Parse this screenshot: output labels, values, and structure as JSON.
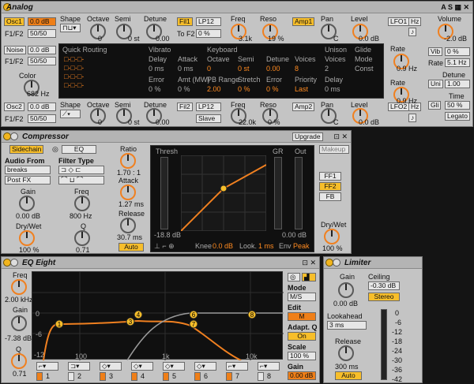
{
  "analog": {
    "title": "Analog",
    "osc1": "Osc1",
    "osc1_db": "0.0 dB",
    "f1f2": "F1/F2",
    "f1f2_val": "50/50",
    "shape": "Shape",
    "octave": "Octave",
    "octave_v": "0",
    "semi": "Semi",
    "semi_v": "0 st",
    "detune": "Detune",
    "detune_v": "0.00",
    "fil1": "Fil1",
    "fil1_type": "LP12",
    "freq": "Freq",
    "freq_v": "3.1k",
    "reso": "Reso",
    "reso_v": "19 %",
    "tof2": "To F2",
    "tof2_v": "0 %",
    "amp1": "Amp1",
    "pan": "Pan",
    "pan_v": "C",
    "level": "Level",
    "level_v": "0.0 dB",
    "lfo1": "LFO1",
    "hz": "Hz",
    "volume": "Volume",
    "volume_v": "-2.0 dB",
    "noise": "Noise",
    "noise_db": "0.0 dB",
    "noise_f": "F1/F2",
    "noise_f_v": "50/50",
    "color": "Color",
    "color_v": "682 Hz",
    "qr": "Quick Routing",
    "vibrato": "Vibrato",
    "v_delay": "Delay",
    "v_delay_v": "0 ms",
    "v_error": "Error",
    "v_error_v": "0 %",
    "keyboard": "Keyboard",
    "k_attack": "Attack",
    "k_attack_v": "0 ms",
    "k_octave": "Octave",
    "k_octave_v": "0",
    "k_semi": "Semi",
    "k_semi_v": "0 st",
    "k_detune": "Detune",
    "k_detune_v": "0.00",
    "k_amt": "Amt (MW)",
    "k_amt_v": "0 %",
    "k_fb": "PB Range",
    "k_fb_v": "2.00",
    "k_stretch": "Stretch",
    "k_stretch_v": "0 %",
    "k_error": "Error",
    "k_error_v": "0 %",
    "unison": "Unison",
    "u_voices": "Voices",
    "u_voices_v": "8",
    "u_voices2": "Voices",
    "u_voices2_v": "2",
    "u_priority": "Priority",
    "u_priority_v": "Last",
    "u_delay": "Delay",
    "u_delay_v": "0 ms",
    "glide": "Glide",
    "g_mode": "Mode",
    "g_mode_v": "Const",
    "rate": "Rate",
    "rate_v": "0.9 Hz",
    "vib": "Vib",
    "vib_v": "0 %",
    "rate2": "Rate",
    "rate2_v": "5.1 Hz",
    "uni": "Uni",
    "uni_v": "1.00",
    "detune2": "Detune",
    "glide2": "Gli",
    "glide2_v": "50 %",
    "time": "Time",
    "legato": "Legato",
    "osc2": "Osc2",
    "osc2_db": "0.0 dB",
    "osc2_f": "F1/F2",
    "osc2_f_v": "50/50",
    "shape2": "Shape",
    "octave2": "Octave",
    "octave2_v": "0",
    "semi2": "Semi",
    "semi2_v": "0 st",
    "detune3": "Detune",
    "detune3_v": "0.00",
    "fil2": "Fil2",
    "fil2_type": "LP12",
    "freq2": "Freq",
    "freq2_v": "22.0k",
    "reso2": "Reso",
    "reso2_v": "0 %",
    "slave": "Slave",
    "amp2": "Amp2",
    "pan2": "Pan",
    "pan2_v": "C",
    "level2": "Level",
    "level2_v": "0.0 dB",
    "lfo2": "LFO2",
    "hz2": "Hz",
    "rate3": "Rate",
    "rate3_v": "0.9 Hz"
  },
  "comp": {
    "title": "Compressor",
    "upgrade": "Upgrade",
    "sidechain": "Sidechain",
    "eq": "EQ",
    "audio_from": "Audio From",
    "breaks": "breaks",
    "postfx": "Post FX",
    "filter_type": "Filter Type",
    "gain": "Gain",
    "gain_v": "0.00 dB",
    "freq": "Freq",
    "freq_v": "800 Hz",
    "drywet": "Dry/Wet",
    "drywet_v": "100 %",
    "q": "Q",
    "q_v": "0.71",
    "ratio": "Ratio",
    "ratio_v": "1.70 : 1",
    "attack": "Attack",
    "attack_v": "1.27 ms",
    "release": "Release",
    "release_v": "30.7 ms",
    "auto": "Auto",
    "thresh": "Thresh",
    "gr": "GR",
    "out": "Out",
    "thresh_v": "-18.8 dB",
    "out_v": "0.00 dB",
    "knee": "Knee",
    "knee_v": "0.0 dB",
    "look": "Look.",
    "look_v": "1 ms",
    "env": "Env",
    "env_v": "Peak",
    "makeup": "Makeup",
    "ff1": "FF1",
    "ff2": "FF2",
    "fb": "FB",
    "dw2": "Dry/Wet",
    "dw2_v": "100 %"
  },
  "eq": {
    "title": "EQ Eight",
    "freq": "Freq",
    "freq_v": "2.00 kHz",
    "gain": "Gain",
    "gain_v": "-7.38 dB",
    "q": "Q",
    "q_v": "0.71",
    "ticks": [
      "0",
      "-6",
      "-12"
    ],
    "xticks": [
      "100",
      "1k",
      "10k"
    ],
    "mode": "Mode",
    "mode_v": "M/S",
    "edit": "Edit",
    "edit_v": "M",
    "adapt": "Adapt. Q",
    "adapt_v": "On",
    "scale": "Scale",
    "scale_v": "100 %",
    "gain2": "Gain",
    "gain2_v": "0.00 dB",
    "bands": [
      "1",
      "2",
      "3",
      "4",
      "5",
      "6",
      "7",
      "8"
    ]
  },
  "limiter": {
    "title": "Limiter",
    "gain": "Gain",
    "gain_v": "0.00 dB",
    "ceiling": "Ceiling",
    "ceiling_v": "-0.30 dB",
    "stereo": "Stereo",
    "lookahead": "Lookahead",
    "lookahead_v": "3 ms",
    "release": "Release",
    "release_v": "300 ms",
    "auto": "Auto",
    "ticks": [
      "0",
      "-6",
      "-12",
      "-18",
      "-24",
      "-30",
      "-36",
      "-42"
    ]
  }
}
